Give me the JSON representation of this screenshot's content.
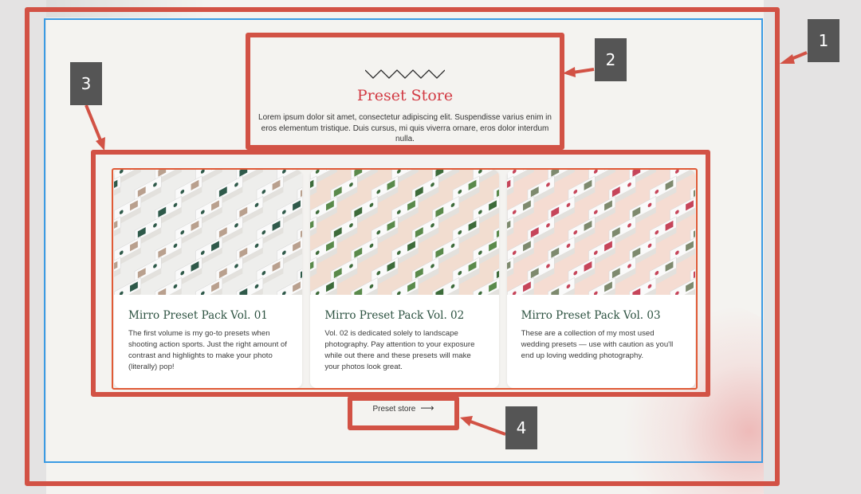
{
  "hero": {
    "title": "Preset Store",
    "description": "Lorem ipsum dolor sit amet, consectetur adipiscing elit. Suspendisse varius enim in eros elementum tristique. Duis cursus, mi quis viverra ornare, eros dolor interdum nulla."
  },
  "cards": [
    {
      "title": "Mirro Preset Pack Vol. 01",
      "description": "The first volume is my go-to presets when shooting action sports. Just the right amount of contrast and highlights to make your photo (literally) pop!",
      "bg": "#eeeeec",
      "accent": "#2f5a4a",
      "accent2": "#b9a08e"
    },
    {
      "title": "Mirro Preset Pack Vol. 02",
      "description": "Vol. 02 is dedicated solely to landscape photography. Pay attention to your exposure while out there and these presets will make your photos look great.",
      "bg": "#f2ddd0",
      "accent": "#3d6b3a",
      "accent2": "#5a8a4b"
    },
    {
      "title": "Mirro Preset Pack Vol. 03",
      "description": "These are a collection of my most used wedding presets — use with caution as you'll end up loving wedding photography.",
      "bg": "#f5dcd2",
      "accent": "#c6455a",
      "accent2": "#7e8a6e"
    }
  ],
  "store_link": {
    "label": "Preset store",
    "icon": "arrow-right-icon"
  },
  "annotations": [
    "1",
    "2",
    "3",
    "4"
  ],
  "colors": {
    "annotation": "#d25245",
    "selection": "#3a9be3",
    "title_red": "#d23b44",
    "card_title_green": "#2d5241"
  }
}
